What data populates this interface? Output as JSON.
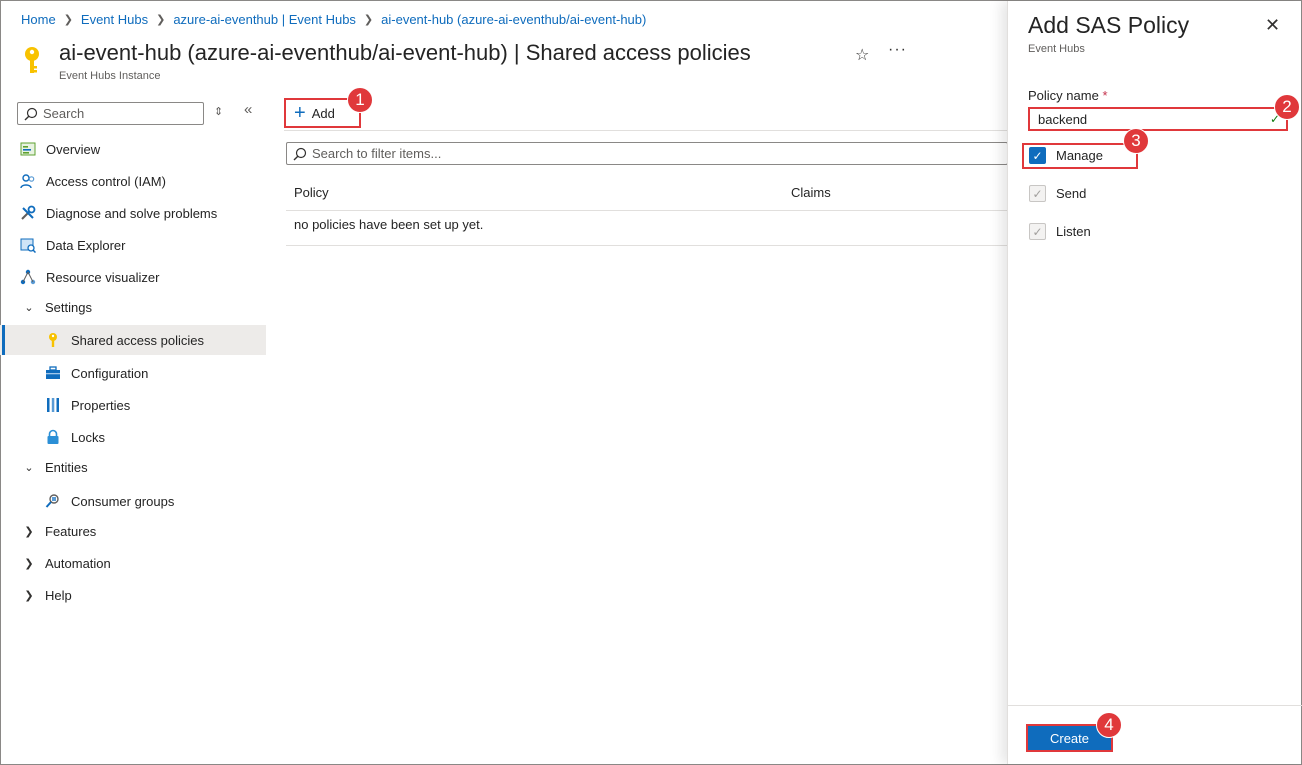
{
  "breadcrumb": [
    "Home",
    "Event Hubs",
    "azure-ai-eventhub | Event Hubs",
    "ai-event-hub (azure-ai-eventhub/ai-event-hub)"
  ],
  "header": {
    "title": "ai-event-hub (azure-ai-eventhub/ai-event-hub) | Shared access policies",
    "subtitle": "Event Hubs Instance"
  },
  "nav": {
    "search_placeholder": "Search",
    "items": [
      {
        "label": "Overview",
        "icon": "overview-icon"
      },
      {
        "label": "Access control (IAM)",
        "icon": "people-icon"
      },
      {
        "label": "Diagnose and solve problems",
        "icon": "wrench-icon"
      },
      {
        "label": "Data Explorer",
        "icon": "data-explorer-icon"
      },
      {
        "label": "Resource visualizer",
        "icon": "visualizer-icon"
      },
      {
        "label": "Settings",
        "icon": "chevron-down-icon"
      },
      {
        "label": "Shared access policies",
        "icon": "key-icon"
      },
      {
        "label": "Configuration",
        "icon": "toolbox-icon"
      },
      {
        "label": "Properties",
        "icon": "properties-icon"
      },
      {
        "label": "Locks",
        "icon": "lock-icon"
      },
      {
        "label": "Entities",
        "icon": "chevron-down-icon"
      },
      {
        "label": "Consumer groups",
        "icon": "consumer-groups-icon"
      },
      {
        "label": "Features",
        "icon": "chevron-right-icon"
      },
      {
        "label": "Automation",
        "icon": "chevron-right-icon"
      },
      {
        "label": "Help",
        "icon": "chevron-right-icon"
      }
    ]
  },
  "main": {
    "add_label": "Add",
    "filter_placeholder": "Search to filter items...",
    "columns": [
      "Policy",
      "Claims"
    ],
    "empty_message": "no policies have been set up yet."
  },
  "panel": {
    "title": "Add SAS Policy",
    "subtitle": "Event Hubs",
    "policy_name_label": "Policy name",
    "required_mark": "*",
    "policy_name_value": "backend",
    "checkboxes": [
      {
        "label": "Manage",
        "checked": true
      },
      {
        "label": "Send",
        "checked": true
      },
      {
        "label": "Listen",
        "checked": true
      }
    ],
    "create_label": "Create"
  },
  "badges": [
    "1",
    "2",
    "3",
    "4"
  ],
  "colors": {
    "accent": "#0f6cbd",
    "highlight": "#e0383b"
  }
}
